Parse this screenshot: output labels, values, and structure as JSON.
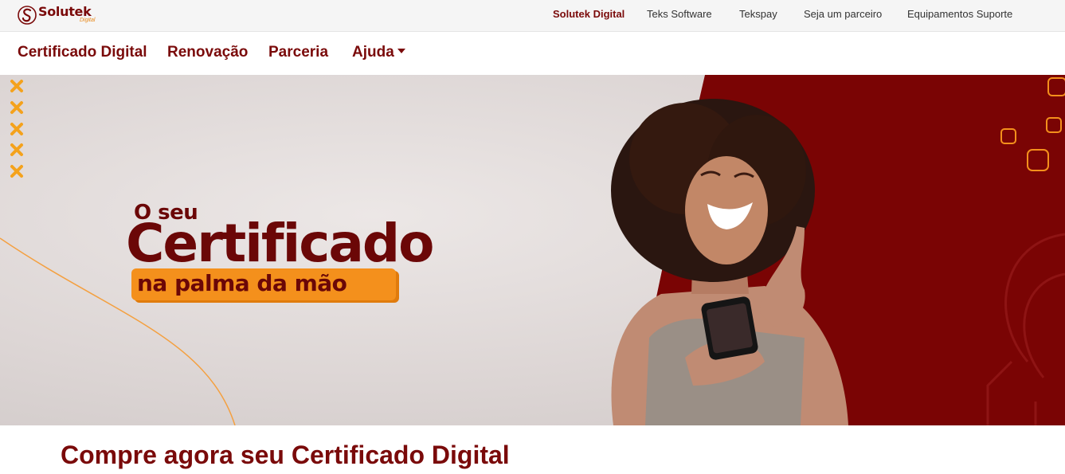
{
  "brand": {
    "name": "Solutek",
    "sub": "Digital",
    "primary_color": "#7a0a0a",
    "accent_color": "#f4901c"
  },
  "topbar": {
    "links": [
      {
        "label": "Solutek Digital",
        "active": true
      },
      {
        "label": "Teks Software",
        "active": false
      },
      {
        "label": "Tekspay",
        "active": false
      },
      {
        "label": "Seja um parceiro",
        "active": false
      },
      {
        "label": "Equipamentos Suporte",
        "active": false
      }
    ]
  },
  "mainnav": {
    "items": [
      {
        "label": "Certificado Digital"
      },
      {
        "label": "Renovação"
      },
      {
        "label": "Parceria"
      },
      {
        "label": "Ajuda",
        "icon": "caret-down-icon"
      }
    ]
  },
  "hero": {
    "line1": "O seu",
    "line2": "Certificado",
    "line3": "na palma da mão",
    "decor_icon": "x-mark-icon",
    "image": "smiling-woman-holding-smartphone"
  },
  "section": {
    "title": "Compre agora seu Certificado Digital"
  }
}
